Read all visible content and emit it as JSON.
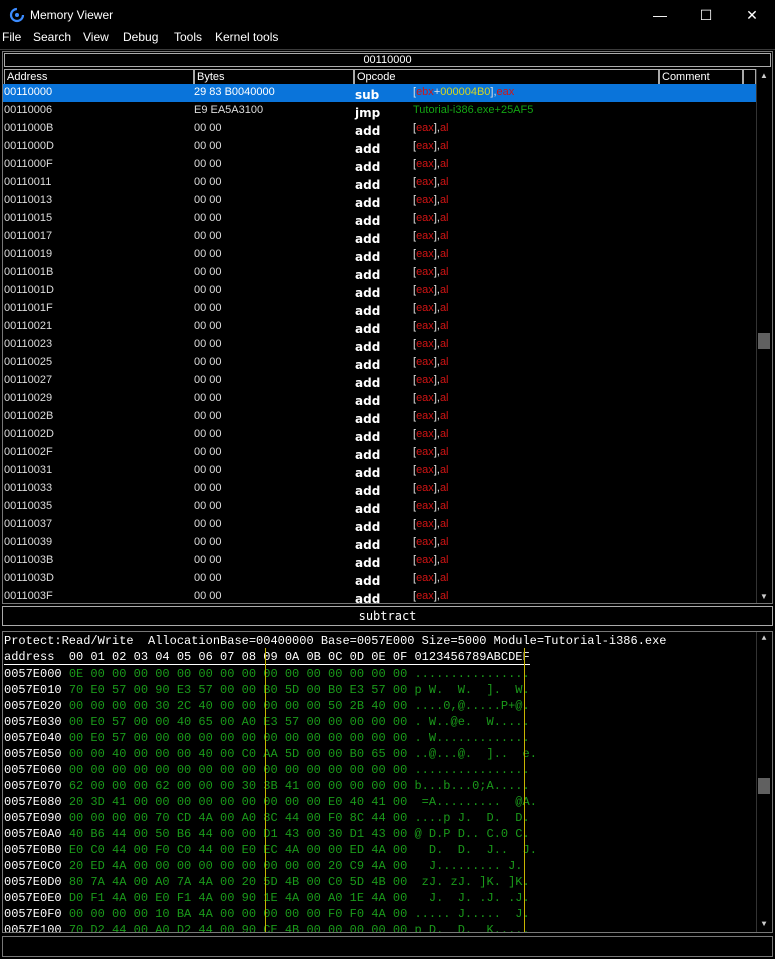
{
  "window": {
    "title": "Memory Viewer",
    "minimize": "—",
    "maximize": "☐",
    "close": "✕"
  },
  "menu": [
    "File",
    "Search",
    "View",
    "Debug",
    "Tools",
    "Kernel tools"
  ],
  "disasm": {
    "address_bar": "00110000",
    "columns": {
      "address": "Address",
      "bytes": "Bytes",
      "opcode": "Opcode",
      "comment": "Comment"
    },
    "rows": [
      {
        "addr": "00110000",
        "bytes": "29 83 B0040000",
        "op": "sub",
        "args": [
          [
            "br",
            "["
          ],
          [
            "reg",
            "ebx"
          ],
          [
            "br",
            "+"
          ],
          [
            "imm",
            "000004B0"
          ],
          [
            "br",
            "],"
          ],
          [
            "reg",
            "eax"
          ]
        ],
        "selected": true
      },
      {
        "addr": "00110006",
        "bytes": "E9 EA5A3100",
        "op": "jmp",
        "args": [
          [
            "sym",
            "Tutorial-i386.exe+25AF5"
          ]
        ]
      },
      {
        "addr": "0011000B",
        "bytes": "00 00",
        "op": "add",
        "args": [
          [
            "br",
            "["
          ],
          [
            "reg",
            "eax"
          ],
          [
            "br",
            "],"
          ],
          [
            "reg",
            "al"
          ]
        ]
      },
      {
        "addr": "0011000D",
        "bytes": "00 00",
        "op": "add",
        "args": [
          [
            "br",
            "["
          ],
          [
            "reg",
            "eax"
          ],
          [
            "br",
            "],"
          ],
          [
            "reg",
            "al"
          ]
        ]
      },
      {
        "addr": "0011000F",
        "bytes": "00 00",
        "op": "add",
        "args": [
          [
            "br",
            "["
          ],
          [
            "reg",
            "eax"
          ],
          [
            "br",
            "],"
          ],
          [
            "reg",
            "al"
          ]
        ]
      },
      {
        "addr": "00110011",
        "bytes": "00 00",
        "op": "add",
        "args": [
          [
            "br",
            "["
          ],
          [
            "reg",
            "eax"
          ],
          [
            "br",
            "],"
          ],
          [
            "reg",
            "al"
          ]
        ]
      },
      {
        "addr": "00110013",
        "bytes": "00 00",
        "op": "add",
        "args": [
          [
            "br",
            "["
          ],
          [
            "reg",
            "eax"
          ],
          [
            "br",
            "],"
          ],
          [
            "reg",
            "al"
          ]
        ]
      },
      {
        "addr": "00110015",
        "bytes": "00 00",
        "op": "add",
        "args": [
          [
            "br",
            "["
          ],
          [
            "reg",
            "eax"
          ],
          [
            "br",
            "],"
          ],
          [
            "reg",
            "al"
          ]
        ]
      },
      {
        "addr": "00110017",
        "bytes": "00 00",
        "op": "add",
        "args": [
          [
            "br",
            "["
          ],
          [
            "reg",
            "eax"
          ],
          [
            "br",
            "],"
          ],
          [
            "reg",
            "al"
          ]
        ]
      },
      {
        "addr": "00110019",
        "bytes": "00 00",
        "op": "add",
        "args": [
          [
            "br",
            "["
          ],
          [
            "reg",
            "eax"
          ],
          [
            "br",
            "],"
          ],
          [
            "reg",
            "al"
          ]
        ]
      },
      {
        "addr": "0011001B",
        "bytes": "00 00",
        "op": "add",
        "args": [
          [
            "br",
            "["
          ],
          [
            "reg",
            "eax"
          ],
          [
            "br",
            "],"
          ],
          [
            "reg",
            "al"
          ]
        ]
      },
      {
        "addr": "0011001D",
        "bytes": "00 00",
        "op": "add",
        "args": [
          [
            "br",
            "["
          ],
          [
            "reg",
            "eax"
          ],
          [
            "br",
            "],"
          ],
          [
            "reg",
            "al"
          ]
        ]
      },
      {
        "addr": "0011001F",
        "bytes": "00 00",
        "op": "add",
        "args": [
          [
            "br",
            "["
          ],
          [
            "reg",
            "eax"
          ],
          [
            "br",
            "],"
          ],
          [
            "reg",
            "al"
          ]
        ]
      },
      {
        "addr": "00110021",
        "bytes": "00 00",
        "op": "add",
        "args": [
          [
            "br",
            "["
          ],
          [
            "reg",
            "eax"
          ],
          [
            "br",
            "],"
          ],
          [
            "reg",
            "al"
          ]
        ]
      },
      {
        "addr": "00110023",
        "bytes": "00 00",
        "op": "add",
        "args": [
          [
            "br",
            "["
          ],
          [
            "reg",
            "eax"
          ],
          [
            "br",
            "],"
          ],
          [
            "reg",
            "al"
          ]
        ]
      },
      {
        "addr": "00110025",
        "bytes": "00 00",
        "op": "add",
        "args": [
          [
            "br",
            "["
          ],
          [
            "reg",
            "eax"
          ],
          [
            "br",
            "],"
          ],
          [
            "reg",
            "al"
          ]
        ]
      },
      {
        "addr": "00110027",
        "bytes": "00 00",
        "op": "add",
        "args": [
          [
            "br",
            "["
          ],
          [
            "reg",
            "eax"
          ],
          [
            "br",
            "],"
          ],
          [
            "reg",
            "al"
          ]
        ]
      },
      {
        "addr": "00110029",
        "bytes": "00 00",
        "op": "add",
        "args": [
          [
            "br",
            "["
          ],
          [
            "reg",
            "eax"
          ],
          [
            "br",
            "],"
          ],
          [
            "reg",
            "al"
          ]
        ]
      },
      {
        "addr": "0011002B",
        "bytes": "00 00",
        "op": "add",
        "args": [
          [
            "br",
            "["
          ],
          [
            "reg",
            "eax"
          ],
          [
            "br",
            "],"
          ],
          [
            "reg",
            "al"
          ]
        ]
      },
      {
        "addr": "0011002D",
        "bytes": "00 00",
        "op": "add",
        "args": [
          [
            "br",
            "["
          ],
          [
            "reg",
            "eax"
          ],
          [
            "br",
            "],"
          ],
          [
            "reg",
            "al"
          ]
        ]
      },
      {
        "addr": "0011002F",
        "bytes": "00 00",
        "op": "add",
        "args": [
          [
            "br",
            "["
          ],
          [
            "reg",
            "eax"
          ],
          [
            "br",
            "],"
          ],
          [
            "reg",
            "al"
          ]
        ]
      },
      {
        "addr": "00110031",
        "bytes": "00 00",
        "op": "add",
        "args": [
          [
            "br",
            "["
          ],
          [
            "reg",
            "eax"
          ],
          [
            "br",
            "],"
          ],
          [
            "reg",
            "al"
          ]
        ]
      },
      {
        "addr": "00110033",
        "bytes": "00 00",
        "op": "add",
        "args": [
          [
            "br",
            "["
          ],
          [
            "reg",
            "eax"
          ],
          [
            "br",
            "],"
          ],
          [
            "reg",
            "al"
          ]
        ]
      },
      {
        "addr": "00110035",
        "bytes": "00 00",
        "op": "add",
        "args": [
          [
            "br",
            "["
          ],
          [
            "reg",
            "eax"
          ],
          [
            "br",
            "],"
          ],
          [
            "reg",
            "al"
          ]
        ]
      },
      {
        "addr": "00110037",
        "bytes": "00 00",
        "op": "add",
        "args": [
          [
            "br",
            "["
          ],
          [
            "reg",
            "eax"
          ],
          [
            "br",
            "],"
          ],
          [
            "reg",
            "al"
          ]
        ]
      },
      {
        "addr": "00110039",
        "bytes": "00 00",
        "op": "add",
        "args": [
          [
            "br",
            "["
          ],
          [
            "reg",
            "eax"
          ],
          [
            "br",
            "],"
          ],
          [
            "reg",
            "al"
          ]
        ]
      },
      {
        "addr": "0011003B",
        "bytes": "00 00",
        "op": "add",
        "args": [
          [
            "br",
            "["
          ],
          [
            "reg",
            "eax"
          ],
          [
            "br",
            "],"
          ],
          [
            "reg",
            "al"
          ]
        ]
      },
      {
        "addr": "0011003D",
        "bytes": "00 00",
        "op": "add",
        "args": [
          [
            "br",
            "["
          ],
          [
            "reg",
            "eax"
          ],
          [
            "br",
            "],"
          ],
          [
            "reg",
            "al"
          ]
        ]
      },
      {
        "addr": "0011003F",
        "bytes": "00 00",
        "op": "add",
        "args": [
          [
            "br",
            "["
          ],
          [
            "reg",
            "eax"
          ],
          [
            "br",
            "],"
          ],
          [
            "reg",
            "al"
          ]
        ]
      }
    ]
  },
  "opcode_description": "subtract",
  "hexview": {
    "info": "Protect:Read/Write  AllocationBase=00400000 Base=0057E000 Size=5000 Module=Tutorial-i386.exe",
    "header": "address  00 01 02 03 04 05 06 07 08 09 0A 0B 0C 0D 0E 0F 0123456789ABCDEF",
    "rows": [
      {
        "addr": "0057E000",
        "hex": "0E 00 00 00 00 00 00 00 00 00 00 00 00 00 00 00",
        "ascii": "................"
      },
      {
        "addr": "0057E010",
        "hex": "70 E0 57 00 90 E3 57 00 00 B0 5D 00 B0 E3 57 00",
        "ascii": "p W.  W.  ].  W."
      },
      {
        "addr": "0057E020",
        "hex": "00 00 00 00 30 2C 40 00 00 00 00 00 50 2B 40 00",
        "ascii": "....0,@.....P+@."
      },
      {
        "addr": "0057E030",
        "hex": "00 E0 57 00 00 40 65 00 A0 E3 57 00 00 00 00 00",
        "ascii": ". W..@e.  W....."
      },
      {
        "addr": "0057E040",
        "hex": "00 E0 57 00 00 00 00 00 00 00 00 00 00 00 00 00",
        "ascii": ". W............."
      },
      {
        "addr": "0057E050",
        "hex": "00 00 40 00 00 00 40 00 C0 AA 5D 00 00 B0 65 00",
        "ascii": "..@...@.  ]..  e."
      },
      {
        "addr": "0057E060",
        "hex": "00 00 00 00 00 00 00 00 00 00 00 00 00 00 00 00",
        "ascii": "................"
      },
      {
        "addr": "0057E070",
        "hex": "62 00 00 00 62 00 00 00 30 3B 41 00 00 00 00 00",
        "ascii": "b...b...0;A....."
      },
      {
        "addr": "0057E080",
        "hex": "20 3D 41 00 00 00 00 00 00 00 00 00 E0 40 41 00",
        "ascii": " =A.........  @A."
      },
      {
        "addr": "0057E090",
        "hex": "00 00 00 00 70 CD 4A 00 A0 8C 44 00 F0 8C 44 00",
        "ascii": "....p J.  D.  D."
      },
      {
        "addr": "0057E0A0",
        "hex": "40 B6 44 00 50 B6 44 00 00 D1 43 00 30 D1 43 00",
        "ascii": "@ D.P D.. C.0 C."
      },
      {
        "addr": "0057E0B0",
        "hex": "E0 C0 44 00 F0 C0 44 00 E0 EC 4A 00 00 ED 4A 00",
        "ascii": "  D.  D.  J..  J."
      },
      {
        "addr": "0057E0C0",
        "hex": "20 ED 4A 00 00 00 00 00 00 00 00 00 20 C9 4A 00",
        "ascii": "  J......... J."
      },
      {
        "addr": "0057E0D0",
        "hex": "80 7A 4A 00 A0 7A 4A 00 20 5D 4B 00 C0 5D 4B 00",
        "ascii": " zJ. zJ. ]K. ]K."
      },
      {
        "addr": "0057E0E0",
        "hex": "D0 F1 4A 00 E0 F1 4A 00 90 1E 4A 00 A0 1E 4A 00",
        "ascii": "  J.  J. .J. .J."
      },
      {
        "addr": "0057E0F0",
        "hex": "00 00 00 00 10 BA 4A 00 00 00 00 00 F0 F0 4A 00",
        "ascii": "..... J.....  J."
      },
      {
        "addr": "0057E100",
        "hex": "70 D2 44 00 A0 D2 44 00 90 CE 4B 00 00 00 00 00",
        "ascii": "p D.  D.  K....."
      }
    ]
  },
  "icons": {
    "app": "cheat-engine-icon",
    "scroll_up": "▲",
    "scroll_down": "▼"
  },
  "colors": {
    "selection": "#0a74da",
    "register": "#d21414",
    "immediate": "#d7d71e",
    "symbol": "#13a513",
    "hex_bytes": "#1a9a1a"
  }
}
